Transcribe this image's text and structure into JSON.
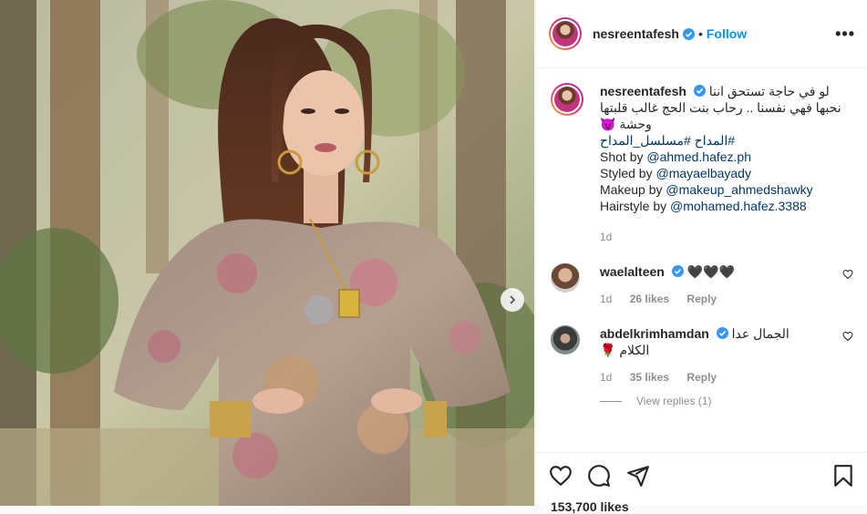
{
  "post": {
    "username": "nesreentafesh",
    "follow_label": "Follow",
    "dot": "•",
    "more_label": "•••"
  },
  "caption": {
    "username": "nesreentafesh",
    "line1": "لو في حاجة تستحق اننا",
    "line2": "نحبها فهي نفسنا .. رحاب بنت الحج غالب قلبتها",
    "line3": "وحشة 😈",
    "hashtags": "#المداح #مسلسل_المداح",
    "shot_prefix": "Shot by ",
    "shot_handle": "@ahmed.hafez.ph",
    "styled_prefix": "Styled by ",
    "styled_handle": "@mayaelbayady",
    "makeup_prefix": "Makeup by ",
    "makeup_handle": "@makeup_ahmedshawky",
    "hair_prefix": "Hairstyle by ",
    "hair_handle": "@mohamed.hafez.3388",
    "time": "1d"
  },
  "comments": [
    {
      "username": "waelalteen",
      "text": "🖤🖤🖤",
      "time": "1d",
      "likes": "26 likes",
      "reply": "Reply"
    },
    {
      "username": "abdelkrimhamdan",
      "text": "الجمال عدا",
      "text2": "الكلام 🌹",
      "time": "1d",
      "likes": "35 likes",
      "reply": "Reply"
    }
  ],
  "view_replies": "View replies (1)",
  "likes_count": "153,700 likes",
  "colors": {
    "link": "#00376b",
    "follow": "#0095f6",
    "verified": "#3897f0"
  }
}
